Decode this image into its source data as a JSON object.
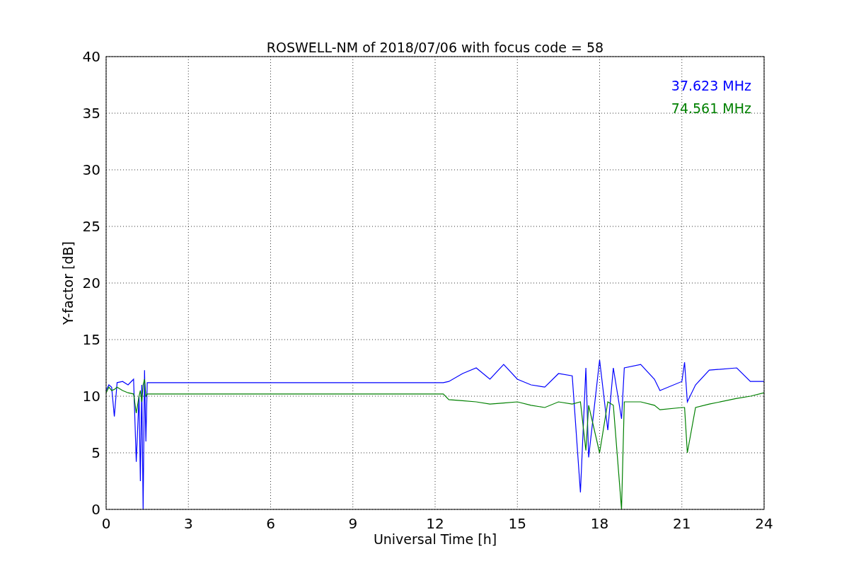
{
  "chart_data": {
    "type": "line",
    "title": "ROSWELL-NM of 2018/07/06 with focus code = 58",
    "xlabel": "Universal Time [h]",
    "ylabel": "Y-factor [dB]",
    "x": [
      0,
      0.1,
      0.2,
      0.3,
      0.4,
      0.6,
      0.8,
      1.0,
      1.1,
      1.2,
      1.25,
      1.3,
      1.35,
      1.4,
      1.45,
      1.5,
      12.3,
      12.5,
      13,
      13.5,
      14,
      14.5,
      15,
      15.5,
      16,
      16.5,
      17,
      17.3,
      17.5,
      17.6,
      18,
      18.3,
      18.5,
      18.8,
      18.9,
      19.5,
      20,
      20.2,
      21,
      21.1,
      21.2,
      21.5,
      22,
      23,
      23.5,
      24
    ],
    "series": [
      {
        "name": "37.623 MHz",
        "color": "#0000ff",
        "values": [
          10.5,
          11,
          10.8,
          8.2,
          11.2,
          11.3,
          11,
          11.5,
          4.2,
          10,
          2.5,
          11,
          0,
          12.3,
          6,
          11.2,
          11.2,
          11.3,
          12,
          12.5,
          11.5,
          12.8,
          11.5,
          11,
          10.8,
          12,
          11.8,
          1.5,
          12.5,
          4.6,
          13.2,
          7,
          12.5,
          8,
          12.5,
          12.8,
          11.5,
          10.5,
          11.3,
          13,
          9.5,
          11,
          12.3,
          12.5,
          11.3,
          11.3
        ]
      },
      {
        "name": "74.561 MHz",
        "color": "#008000",
        "values": [
          10.3,
          10.8,
          10.5,
          10.6,
          10.8,
          10.5,
          10.3,
          10.2,
          8.5,
          10,
          10.5,
          9.5,
          11,
          11.5,
          10,
          10.2,
          10.2,
          9.7,
          9.6,
          9.5,
          9.3,
          9.4,
          9.5,
          9.2,
          9,
          9.5,
          9.3,
          9.5,
          5.2,
          9.2,
          5,
          9.5,
          9.2,
          0,
          9.5,
          9.5,
          9.2,
          8.8,
          9,
          9,
          5,
          9,
          9.3,
          9.8,
          10,
          10.3
        ]
      }
    ],
    "grid": true,
    "xlim": [
      0,
      24
    ],
    "ylim": [
      0,
      40
    ],
    "xticks": [
      0,
      3,
      6,
      9,
      12,
      15,
      18,
      21,
      24
    ],
    "yticks": [
      0,
      5,
      10,
      15,
      20,
      25,
      30,
      35,
      40
    ]
  }
}
